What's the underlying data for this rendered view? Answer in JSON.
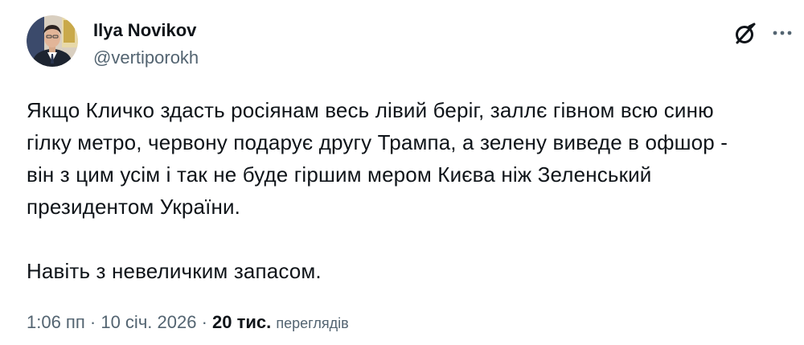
{
  "author": {
    "name": "Ilya Novikov",
    "handle": "@vertiporokh"
  },
  "icons": {
    "grok": "grok-icon",
    "more": "more-icon"
  },
  "tweet": {
    "lines": [
      "Якщо Кличко здасть росіянам весь лівий беріг, заллє гівном всю синю",
      "гілку метро, червону подарує другу Трампа, а зелену виведе в офшор -",
      "він з цим усім і так не буде гіршим мером Києва ніж Зеленський",
      "президентом України."
    ],
    "second_paragraph": "Навіть з невеличким запасом."
  },
  "meta": {
    "time": "1:06 пп",
    "separator": "·",
    "date": "10 січ. 2026",
    "views_count": "20 тис.",
    "views_label": "переглядів"
  },
  "colors": {
    "text": "#0f1419",
    "secondary": "#536471"
  }
}
